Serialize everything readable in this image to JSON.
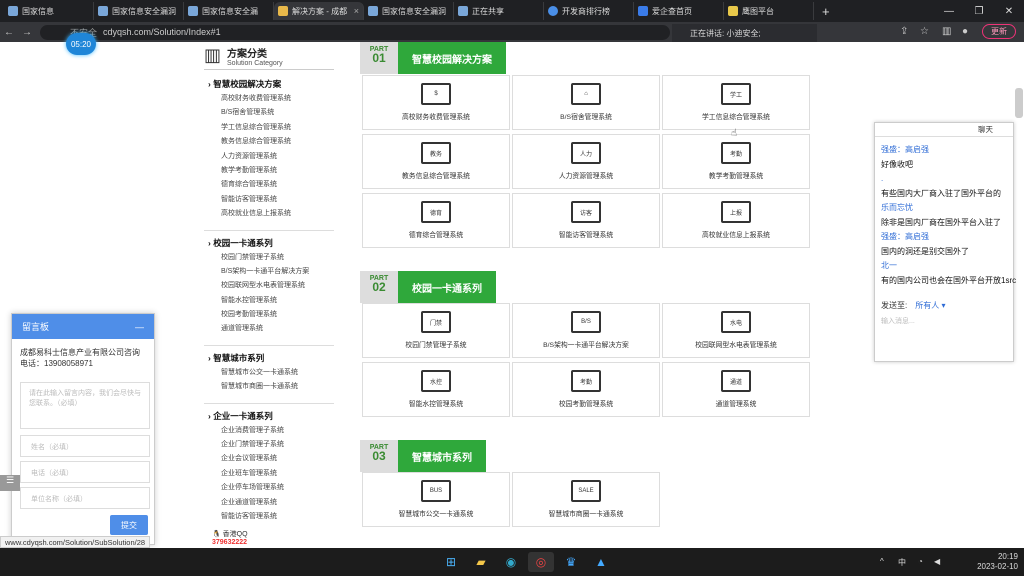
{
  "tabs": [
    "国家信息",
    "国家信息安全漏洞",
    "国家信息安全漏",
    "解决方案 - 成都",
    "国家信息安全漏洞",
    "正在共享",
    "开发商排行榜",
    "爱企查首页",
    "鹰图平台"
  ],
  "url_security": "不安全",
  "url": "cdyqsh.com/Solution/Index#1",
  "timer": "05:20",
  "speaking": "正在讲话: 小迪安全;",
  "update_label": "更新",
  "sidebar": {
    "title": "方案分类",
    "subtitle": "Solution Category",
    "groups": [
      {
        "title": "智慧校园解决方案",
        "items": [
          "高校财务收费管理系统",
          "B/S宿舍管理系统",
          "学工信息综合管理系统",
          "教务信息综合管理系统",
          "人力资源管理系统",
          "教学考勤管理系统",
          "德育综合管理系统",
          "智能访客管理系统",
          "高校就业信息上报系统"
        ]
      },
      {
        "title": "校园一卡通系列",
        "items": [
          "校园门禁管理子系统",
          "B/S架构一卡通平台解决方案",
          "校园联网型水电表管理系统",
          "智能水控管理系统",
          "校园考勤管理系统",
          "通道管理系统"
        ]
      },
      {
        "title": "智慧城市系列",
        "items": [
          "智慧城市公交一卡通系统",
          "智慧城市商圈一卡通系统"
        ]
      },
      {
        "title": "企业一卡通系列",
        "items": [
          "企业消费管理子系统",
          "企业门禁管理子系统",
          "企业会议管理系统",
          "企业班车管理系统",
          "企业停车场管理系统",
          "企业通道管理系统",
          "智能访客管理系统"
        ]
      }
    ],
    "qq_label": "香港QQ",
    "qq_number": "379632222"
  },
  "parts": [
    {
      "pn": "PART",
      "num": "01",
      "title": "智慧校园解决方案"
    },
    {
      "pn": "PART",
      "num": "02",
      "title": "校园一卡通系列"
    },
    {
      "pn": "PART",
      "num": "03",
      "title": "智慧城市系列"
    }
  ],
  "cards": [
    {
      "icon": "$",
      "label": "高校财务收费管理系统"
    },
    {
      "icon": "⌂",
      "label": "B/S宿舍管理系统"
    },
    {
      "icon": "学工",
      "label": "学工信息综合管理系统"
    },
    {
      "icon": "教务",
      "label": "教务信息综合管理系统"
    },
    {
      "icon": "人力",
      "label": "人力资源管理系统"
    },
    {
      "icon": "考勤",
      "label": "教学考勤管理系统"
    },
    {
      "icon": "德育",
      "label": "德育综合管理系统"
    },
    {
      "icon": "访客",
      "label": "智能访客管理系统"
    },
    {
      "icon": "上报",
      "label": "高校就业信息上报系统"
    },
    {
      "icon": "门禁",
      "label": "校园门禁管理子系统"
    },
    {
      "icon": "B/S",
      "label": "B/S架构一卡通平台解决方案"
    },
    {
      "icon": "水电",
      "label": "校园联网型水电表管理系统"
    },
    {
      "icon": "水控",
      "label": "智能水控管理系统"
    },
    {
      "icon": "考勤",
      "label": "校园考勤管理系统"
    },
    {
      "icon": "通道",
      "label": "通道管理系统"
    },
    {
      "icon": "BUS",
      "label": "智慧城市公交一卡通系统"
    },
    {
      "icon": "SALE",
      "label": "智慧城市商圈一卡通系统"
    }
  ],
  "chat": {
    "title": "聊天",
    "messages": [
      {
        "name": "强盛：高启强",
        "text": "好像收吧"
      },
      {
        "name": "",
        "text": "有些国内大厂商入驻了国外平台的"
      },
      {
        "name": "乐而忘忧",
        "text": "除非是国内厂商在国外平台入驻了"
      },
      {
        "name": "强盛：高启强",
        "text": "国内的洞还是别交国外了"
      },
      {
        "name": "北一",
        "text": "有的国内公司也会在国外平台开放1src"
      }
    ],
    "send_to": "发送至:",
    "send_target": "所有人 ▾",
    "placeholder": "输入消息..."
  },
  "msgbox": {
    "title": "留言板",
    "company": "成都易科士信息产业有限公司咨询",
    "phone": "电话：13908058971",
    "textarea_ph": "请在此输入留言内容，我们会尽快与您联系。（必填）",
    "name_ph": "姓名（必填）",
    "tel_ph": "电话（必填）",
    "org_ph": "单位名称（必填）",
    "submit": "提交"
  },
  "status_url": "www.cdyqsh.com/Solution/SubSolution/28",
  "tray": {
    "lang": "中",
    "time": "20:19",
    "date": "2023-02-10"
  }
}
